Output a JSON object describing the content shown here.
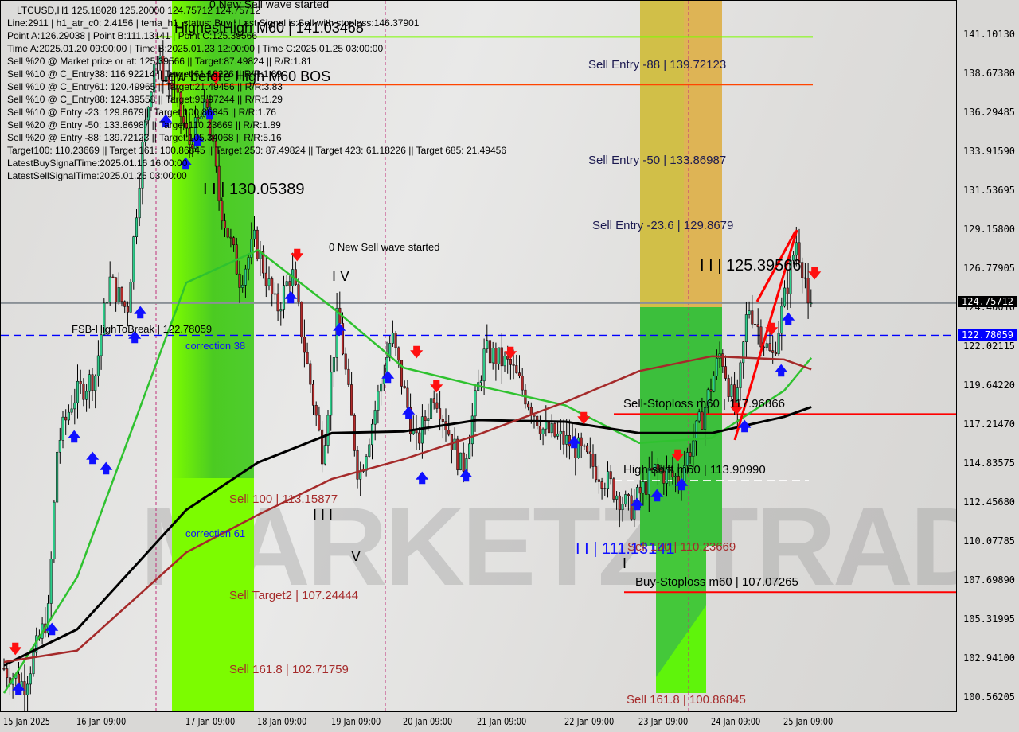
{
  "chart_data": {
    "type": "candlestick",
    "symbol": "LTCUSD,H1",
    "ohlc_header": "LTCUSD,H1  125.18028 125.20000 124.75712 124.75712",
    "ylim": [
      100.56205,
      141.1013
    ],
    "y_ticks": [
      "141.10130",
      "138.67380",
      "136.29485",
      "133.91590",
      "131.53695",
      "129.15800",
      "126.77905",
      "124.40010",
      "122.02115",
      "119.64220",
      "117.21470",
      "114.83575",
      "112.45680",
      "110.07785",
      "107.69890",
      "105.31995",
      "102.94100",
      "100.56205"
    ],
    "x_ticks": [
      "15 Jan 2025",
      "16 Jan 09:00",
      "17 Jan 09:00",
      "18 Jan 09:00",
      "19 Jan 09:00",
      "20 Jan 09:00",
      "21 Jan 09:00",
      "22 Jan 09:00",
      "23 Jan 09:00",
      "24 Jan 09:00",
      "25 Jan 09:00"
    ],
    "current_price": "124.75712",
    "fsb_price": "122.78059",
    "price_path": [
      [
        "2025-01-15 00:00",
        102.4
      ],
      [
        "2025-01-15 09:00",
        101.4
      ],
      [
        "2025-01-15 20:00",
        105.8
      ],
      [
        "2025-01-16 00:00",
        116.0
      ],
      [
        "2025-01-16 07:00",
        118.9
      ],
      [
        "2025-01-16 13:00",
        120.4
      ],
      [
        "2025-01-16 16:00",
        126.2
      ],
      [
        "2025-01-16 20:00",
        124.3
      ],
      [
        "2025-01-16 23:00",
        133.5
      ],
      [
        "2025-01-17 02:00",
        139.8
      ],
      [
        "2025-01-17 06:00",
        137.9
      ],
      [
        "2025-01-17 10:00",
        134.5
      ],
      [
        "2025-01-17 16:00",
        136.9
      ],
      [
        "2025-01-17 20:00",
        131.1
      ],
      [
        "2025-01-18 03:00",
        126.2
      ],
      [
        "2025-01-18 08:00",
        128.6
      ],
      [
        "2025-01-18 15:00",
        124.3
      ],
      [
        "2025-01-18 20:00",
        126.7
      ],
      [
        "2025-01-19 01:00",
        120.9
      ],
      [
        "2025-01-19 06:00",
        115.5
      ],
      [
        "2025-01-19 11:00",
        124.3
      ],
      [
        "2025-01-19 18:00",
        114.0
      ],
      [
        "2025-01-19 23:00",
        117.9
      ],
      [
        "2025-01-20 05:00",
        122.8
      ],
      [
        "2025-01-20 13:00",
        116.0
      ],
      [
        "2025-01-20 19:00",
        119.4
      ],
      [
        "2025-01-21 04:00",
        114.5
      ],
      [
        "2025-01-21 11:00",
        121.8
      ],
      [
        "2025-01-21 18:00",
        120.9
      ],
      [
        "2025-01-22 03:00",
        117.0
      ],
      [
        "2025-01-22 12:00",
        116.0
      ],
      [
        "2025-01-22 22:00",
        114.0
      ],
      [
        "2025-01-23 06:00",
        112.1
      ],
      [
        "2025-01-23 14:00",
        114.5
      ],
      [
        "2025-01-23 22:00",
        114.0
      ],
      [
        "2025-01-24 06:00",
        117.9
      ],
      [
        "2025-01-24 12:00",
        121.8
      ],
      [
        "2025-01-24 17:00",
        117.9
      ],
      [
        "2025-01-24 21:00",
        124.7
      ],
      [
        "2025-01-25 05:00",
        121.3
      ],
      [
        "2025-01-25 13:00",
        128.6
      ],
      [
        "2025-01-25 18:00",
        124.76
      ]
    ],
    "ma_times": [
      "2025-01-15 00:00",
      "2025-01-16 09:00",
      "2025-01-17 09:00",
      "2025-01-18 09:00",
      "2025-01-19 09:00",
      "2025-01-20 09:00",
      "2025-01-21 09:00",
      "2025-01-22 09:00",
      "2025-01-23 09:00",
      "2025-01-24 09:00",
      "2025-01-25 09:00",
      "2025-01-25 18:00"
    ],
    "series": [
      {
        "color": "#2fc22f",
        "values": [
          100.9,
          108,
          126,
          128,
          124.5,
          120.8,
          119.7,
          118.5,
          116.2,
          116.5,
          119.4,
          121.4
        ]
      },
      {
        "color": "#000000",
        "values": [
          102.6,
          104.8,
          112.1,
          115,
          116.8,
          116.9,
          117.6,
          117.5,
          116.8,
          116.8,
          117.8,
          118.4
        ]
      },
      {
        "color": "#a52a2a",
        "values": [
          102.8,
          103.5,
          109.5,
          111.8,
          114.0,
          115.2,
          116.7,
          118.7,
          120.6,
          121.5,
          121.3,
          120.7
        ]
      }
    ],
    "levels": [
      {
        "price": 141.03468,
        "color": "#7cfc00"
      },
      {
        "price": 138.12,
        "color": "#ff4500"
      },
      {
        "price": 122.78059,
        "color": "#0000ff",
        "dash": true
      },
      {
        "price": 124.75712,
        "color": "#8a9096"
      },
      {
        "price": 117.96866,
        "color": "#ff0000"
      },
      {
        "price": 113.9099,
        "color": "#ffffff",
        "dash": true
      },
      {
        "price": 107.07265,
        "color": "#ff0000"
      }
    ],
    "colors": {
      "bull": "#2ecc8a",
      "bear": "#b22a2a",
      "zone_green": "#66ff00",
      "zone_orange": "#f5b96a"
    }
  },
  "info_lines": [
    "Line:2911 | h1_atr_c0: 2.4156 | tema_h1_status: Buy | Last Signal is:Sell with stoploss:146.37901",
    "Point A:126.29038 | Point B:111.13141 | Point C:125.39566",
    "Time A:2025.01.20 09:00:00 | Time B:2025.01.23 12:00:00 | Time C:2025.01.25 03:00:00",
    "Sell %20 @ Market price or at: 125.39566 || Target:87.49824 || R/R:1.81",
    "Sell %10 @ C_Entry38: 116.92214 || Target:61.18226 || R/R:1.89",
    "Sell %10 @ C_Entry61: 120.49965 || Target:21.49456 || R/R:3.83",
    "Sell %10 @ C_Entry88: 124.39558 || Target:95.97244 || R/R:1.29",
    "Sell %10 @ Entry -23: 129.8679 || Target:100.86845 || R/R:1.76",
    "Sell %20 @ Entry -50: 133.86987 || Target:110.23669 || R/R:1.89",
    "Sell %20 @ Entry -88: 139.72123 || Target:105.34068 || R/R:5.16",
    "Target100: 110.23669 || Target 161: 100.86845 || Target 250: 87.49824 || Target 423: 61.18226 || Target 685: 21.49456",
    "LatestBuySignalTime:2025.01.16 16:00:00",
    "LatestSellSignalTime:2025.01.25 03:00:00"
  ],
  "labels": {
    "new_sell_top": "0 New Sell wave started",
    "highest_high": "HighestHigh  M60 | 141.03468",
    "low_before_high": "Low before High  M60 BOS",
    "sell_entry_88": "Sell Entry -88 | 139.72123",
    "sell_entry_50": "Sell Entry -50 | 133.86987",
    "sell_entry_236": "Sell Entry -23.6 | 129.8679",
    "wave_ii": "I I | 125.39566",
    "wave_iii_top": "I I | 130.05389",
    "new_sell_mid": "0 New Sell wave started",
    "wave_iv": "I V",
    "fsb": "FSB-HighToBreak | 122.78059",
    "correction38": "correction 38",
    "sell_stoploss": "Sell-Stoploss m60 | 117.96866",
    "high_shift": "High-shift m60 | 113.90990",
    "sell100": "Sell 100 | 113.15877",
    "wave_iii": "I I I",
    "correction61": "correction 61",
    "wave_v": "V",
    "wave_b": "I I | 111.13141",
    "wave_i": "I",
    "sell100_right": "Sell 100 | 110.23669",
    "buy_stoploss": "Buy-Stoploss m60 | 107.07265",
    "sell_target2": "Sell Target2 | 107.24444",
    "sell1618_left": "Sell 161.8 | 102.71759",
    "sell1618_right": "Sell 161.8 | 100.86845"
  },
  "watermark": "MARKETZITRADE"
}
